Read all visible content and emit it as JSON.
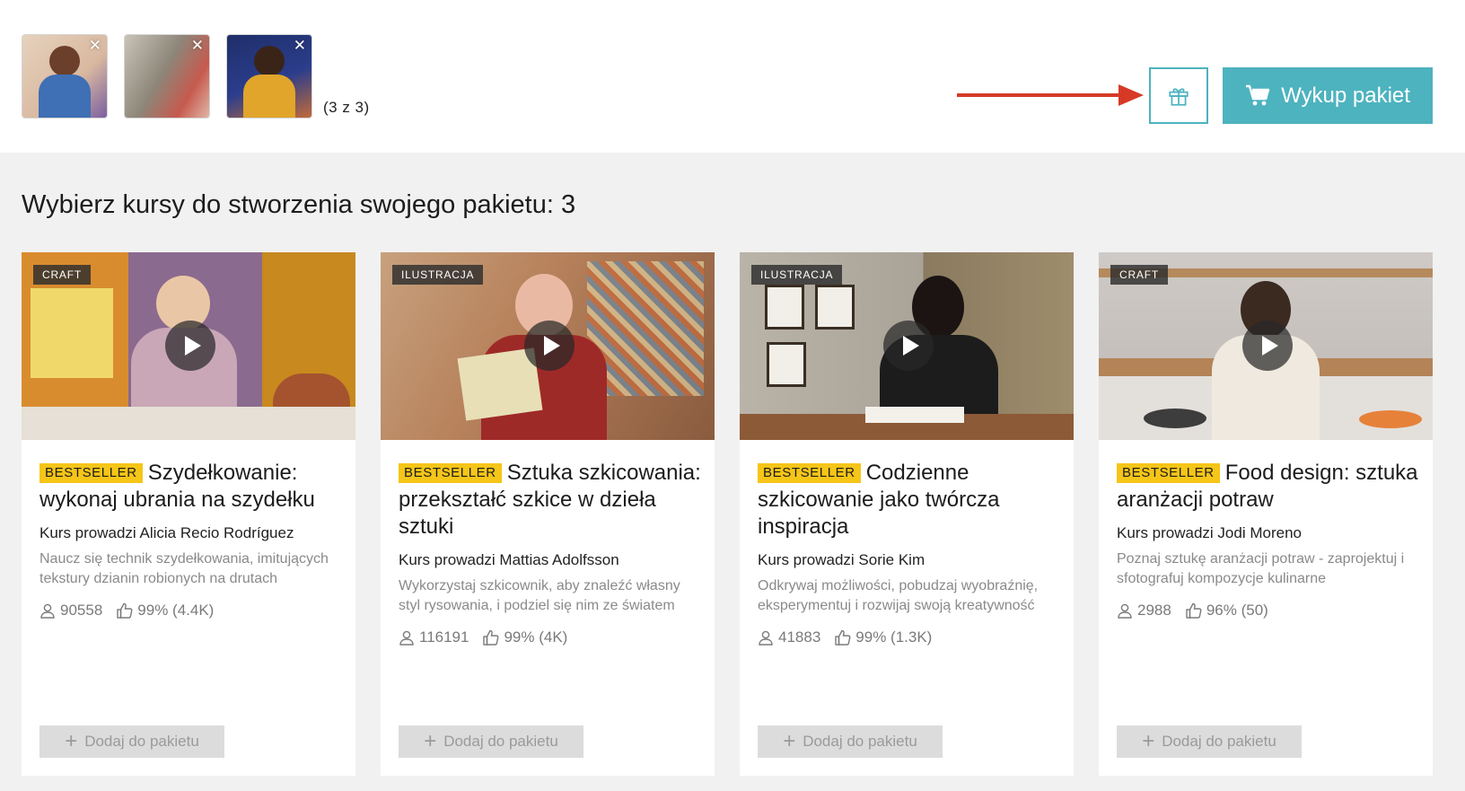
{
  "selection": {
    "thumbnails": [
      {
        "name": "selected-course-1",
        "remove": "✕"
      },
      {
        "name": "selected-course-2",
        "remove": "✕"
      },
      {
        "name": "selected-course-3",
        "remove": "✕"
      }
    ],
    "counter": "(3 z 3)"
  },
  "actions": {
    "gift_icon": "gift-icon",
    "buy_label": "Wykup pakiet",
    "accent": "#4db3bf",
    "arrow_color": "#d63a26"
  },
  "heading": "Wybierz kursy do stworzenia swojego pakietu: 3",
  "courses": [
    {
      "tag": "CRAFT",
      "badge": "BESTSELLER",
      "title": "Szydełkowanie: wykonaj ubrania na szydełku",
      "author": "Kurs prowadzi Alicia Recio Rodríguez",
      "description": "Naucz się technik szydełkowania, imitujących tekstury dzianin robionych na drutach",
      "students": "90558",
      "rating": "99% (4.4K)",
      "add_label": "Dodaj do pakietu"
    },
    {
      "tag": "ILUSTRACJA",
      "badge": "BESTSELLER",
      "title": "Sztuka szkicowania: przekształć szkice w dzieła sztuki",
      "author": "Kurs prowadzi Mattias Adolfsson",
      "description": "Wykorzystaj szkicownik, aby znaleźć własny styl rysowania, i podziel się nim ze światem",
      "students": "116191",
      "rating": "99% (4K)",
      "add_label": "Dodaj do pakietu"
    },
    {
      "tag": "ILUSTRACJA",
      "badge": "BESTSELLER",
      "title": "Codzienne szkicowanie jako twórcza inspiracja",
      "author": "Kurs prowadzi Sorie Kim",
      "description": "Odkrywaj możliwości, pobudzaj wyobraźnię, eksperymentuj i rozwijaj swoją kreatywność",
      "students": "41883",
      "rating": "99% (1.3K)",
      "add_label": "Dodaj do pakietu"
    },
    {
      "tag": "CRAFT",
      "badge": "BESTSELLER",
      "title": "Food design: sztuka aranżacji potraw",
      "author": "Kurs prowadzi Jodi Moreno",
      "description": "Poznaj sztukę aranżacji potraw - zaprojektuj i sfotografuj kompozycje kulinarne",
      "students": "2988",
      "rating": "96% (50)",
      "add_label": "Dodaj do pakietu"
    }
  ]
}
